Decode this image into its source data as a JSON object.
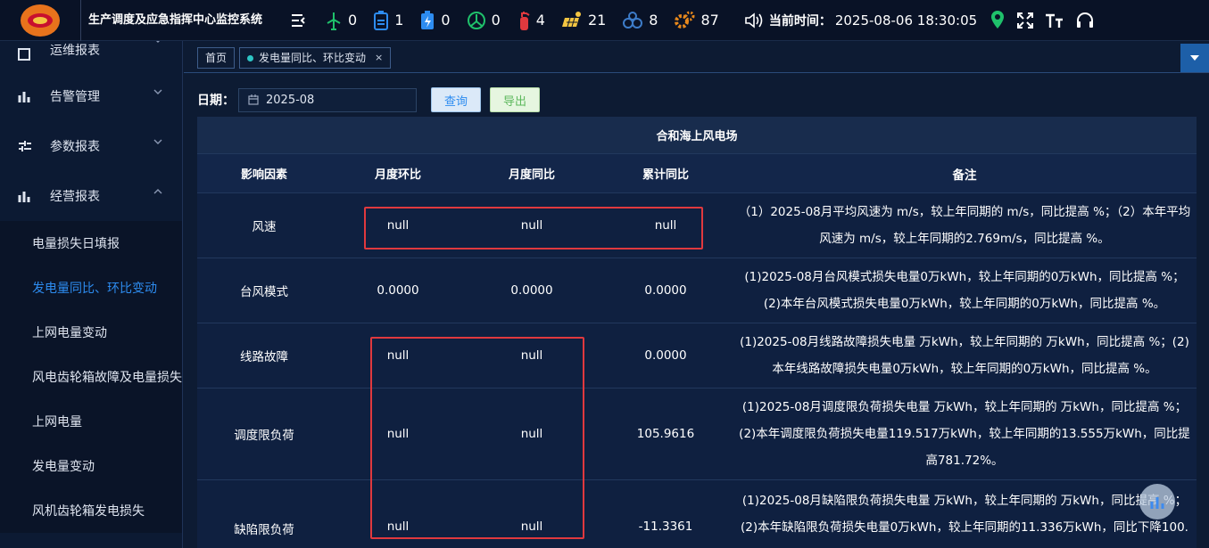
{
  "header": {
    "title": "生产调度及应急指挥中心监控系统",
    "stats": [
      {
        "icon": "wind-turbine-icon",
        "value": "0",
        "color": "#1fc16b"
      },
      {
        "icon": "battery-box-icon",
        "value": "1",
        "color": "#2d8cf0"
      },
      {
        "icon": "battery-charge-icon",
        "value": "0",
        "color": "#2d8cf0"
      },
      {
        "icon": "power-station-icon",
        "value": "0",
        "color": "#1fc16b"
      },
      {
        "icon": "fire-extinguisher-icon",
        "value": "4",
        "color": "#e0393e"
      },
      {
        "icon": "solar-panel-icon",
        "value": "21",
        "color": "#f4c542"
      },
      {
        "icon": "network-icon",
        "value": "8",
        "color": "#3d7cc9"
      },
      {
        "icon": "gear-icon",
        "value": "87",
        "color": "#e8891c"
      }
    ],
    "time_label": "当前时间：",
    "time_value": "2025-08-06 18:30:05"
  },
  "sidebar": {
    "groups": [
      {
        "label": "运维报表"
      },
      {
        "label": "告警管理"
      },
      {
        "label": "参数报表"
      },
      {
        "label": "经营报表"
      }
    ],
    "items": [
      {
        "label": "电量损失日填报"
      },
      {
        "label": "发电量同比、环比变动"
      },
      {
        "label": "上网电量变动"
      },
      {
        "label": "风电齿轮箱故障及电量损失"
      },
      {
        "label": "上网电量"
      },
      {
        "label": "发电量变动"
      },
      {
        "label": "风机齿轮箱发电损失"
      }
    ]
  },
  "tabs": {
    "home": "首页",
    "active": "发电量同比、环比变动",
    "close": "×"
  },
  "filter": {
    "date_label": "日期：",
    "date_value": "2025-08",
    "query_label": "查询",
    "export_label": "导出"
  },
  "table": {
    "title": "合和海上风电场",
    "columns": [
      "影响因素",
      "月度环比",
      "月度同比",
      "累计同比",
      "备注"
    ],
    "rows": [
      {
        "factor": "风速",
        "mom": "null",
        "yoy": "null",
        "cum": "null",
        "note": "（1）2025-08月平均风速为 m/s，较上年同期的 m/s，同比提高 %；（2）本年平均风速为 m/s，较上年同期的2.769m/s，同比提高 %。"
      },
      {
        "factor": "台风模式",
        "mom": "0.0000",
        "yoy": "0.0000",
        "cum": "0.0000",
        "note": "(1)2025-08月台风模式损失电量0万kWh，较上年同期的0万kWh，同比提高 %；(2)本年台风模式损失电量0万kWh，较上年同期的0万kWh，同比提高 %。"
      },
      {
        "factor": "线路故障",
        "mom": "null",
        "yoy": "null",
        "cum": "0.0000",
        "note": "(1)2025-08月线路故障损失电量 万kWh，较上年同期的 万kWh，同比提高 %；(2)本年线路故障损失电量0万kWh，较上年同期的0万kWh，同比提高 %。"
      },
      {
        "factor": "调度限负荷",
        "mom": "null",
        "yoy": "null",
        "cum": "105.9616",
        "note": "(1)2025-08月调度限负荷损失电量 万kWh，较上年同期的 万kWh，同比提高 %；(2)本年调度限负荷损失电量119.517万kWh，较上年同期的13.555万kWh，同比提高781.72%。"
      },
      {
        "factor": "缺陷限负荷",
        "mom": "null",
        "yoy": "null",
        "cum": "-11.3361",
        "note": "(1)2025-08月缺陷限负荷损失电量 万kWh，较上年同期的 万kWh，同比提高 %；(2)本年缺陷限负荷损失电量0万kWh，较上年同期的11.336万kWh，同比下降100."
      }
    ]
  },
  "colors": {
    "highlight": "#e0393e",
    "active_menu": "#2d8cf0"
  }
}
